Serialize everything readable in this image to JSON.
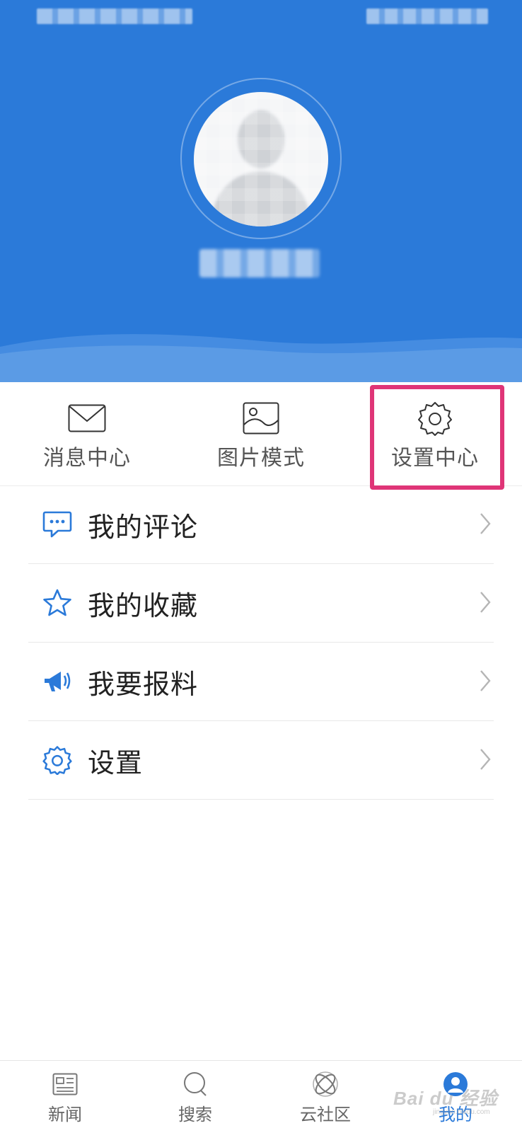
{
  "quick_actions": [
    {
      "label": "消息中心",
      "icon": "envelope-icon"
    },
    {
      "label": "图片模式",
      "icon": "image-icon"
    },
    {
      "label": "设置中心",
      "icon": "gear-icon"
    }
  ],
  "menu": [
    {
      "label": "我的评论",
      "icon": "comment-icon"
    },
    {
      "label": "我的收藏",
      "icon": "star-icon"
    },
    {
      "label": "我要报料",
      "icon": "megaphone-icon"
    },
    {
      "label": "设置",
      "icon": "gear-icon"
    }
  ],
  "bottom_nav": [
    {
      "label": "新闻",
      "icon": "news-icon",
      "active": false
    },
    {
      "label": "搜索",
      "icon": "search-icon",
      "active": false
    },
    {
      "label": "云社区",
      "icon": "atom-icon",
      "active": false
    },
    {
      "label": "我的",
      "icon": "user-icon",
      "active": true
    }
  ],
  "watermark": {
    "text": "Bai du 经验",
    "sub": "jingyan.baidu.com"
  },
  "colors": {
    "header": "#2b7ad9",
    "icon_blue": "#2b7ad9",
    "highlight": "#df3577"
  }
}
